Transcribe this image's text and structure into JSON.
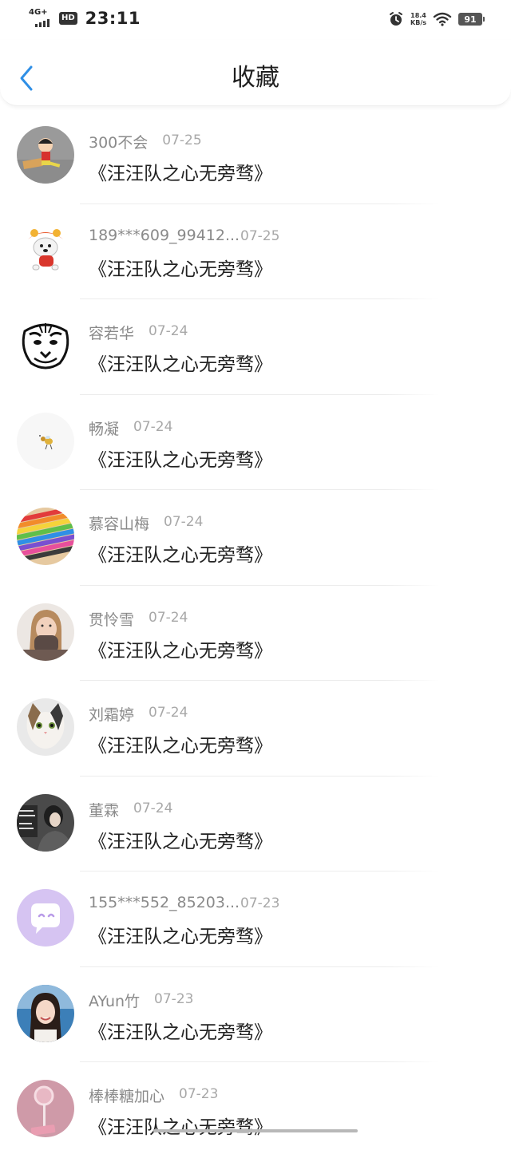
{
  "status_bar": {
    "network": "4G+",
    "hd": "HD",
    "time": "23:11",
    "speed_value": "18.4",
    "speed_unit": "KB/s",
    "battery": "91"
  },
  "header": {
    "title": "收藏",
    "back_icon": "chevron-left-icon"
  },
  "items": [
    {
      "user": "300不会",
      "date": "07-25",
      "book": "《汪汪队之心无旁骛》"
    },
    {
      "user": "189***609_99412...",
      "date": "07-25",
      "book": "《汪汪队之心无旁骛》"
    },
    {
      "user": "容若华",
      "date": "07-24",
      "book": "《汪汪队之心无旁骛》"
    },
    {
      "user": "畅凝",
      "date": "07-24",
      "book": "《汪汪队之心无旁骛》"
    },
    {
      "user": "慕容山梅",
      "date": "07-24",
      "book": "《汪汪队之心无旁骛》"
    },
    {
      "user": "贯怜雪",
      "date": "07-24",
      "book": "《汪汪队之心无旁骛》"
    },
    {
      "user": "刘霜婷",
      "date": "07-24",
      "book": "《汪汪队之心无旁骛》"
    },
    {
      "user": "董霖",
      "date": "07-24",
      "book": "《汪汪队之心无旁骛》"
    },
    {
      "user": "155***552_85203...",
      "date": "07-23",
      "book": "《汪汪队之心无旁骛》"
    },
    {
      "user": "AYun竹",
      "date": "07-23",
      "book": "《汪汪队之心无旁骛》"
    },
    {
      "user": "棒棒糖加心",
      "date": "07-23",
      "book": "《汪汪队之心无旁骛》"
    }
  ],
  "colors": {
    "accent": "#2f8fe6",
    "title_text": "#1f1f1f",
    "meta_text": "#8a8a8a",
    "book_text": "#222222"
  }
}
